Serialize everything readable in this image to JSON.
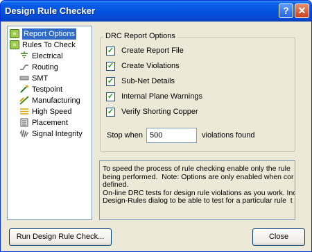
{
  "window": {
    "title": "Design Rule Checker",
    "help_label": "?",
    "close_label": "✕"
  },
  "tree": {
    "items": [
      {
        "label": "Report Options",
        "icon": "report-options-icon",
        "selected": true
      },
      {
        "label": "Rules To Check",
        "icon": "rules-folder-icon",
        "selected": false
      },
      {
        "label": "Electrical",
        "icon": "electrical-icon",
        "selected": false
      },
      {
        "label": "Routing",
        "icon": "routing-icon",
        "selected": false
      },
      {
        "label": "SMT",
        "icon": "smt-icon",
        "selected": false
      },
      {
        "label": "Testpoint",
        "icon": "testpoint-icon",
        "selected": false
      },
      {
        "label": "Manufacturing",
        "icon": "manufacturing-icon",
        "selected": false
      },
      {
        "label": "High Speed",
        "icon": "high-speed-icon",
        "selected": false
      },
      {
        "label": "Placement",
        "icon": "placement-icon",
        "selected": false
      },
      {
        "label": "Signal Integrity",
        "icon": "signal-integrity-icon",
        "selected": false
      }
    ]
  },
  "drc_options": {
    "group_label": "DRC Report Options",
    "checkboxes": [
      {
        "label": "Create Report File",
        "checked": true
      },
      {
        "label": "Create Violations",
        "checked": true
      },
      {
        "label": "Sub-Net Details",
        "checked": true
      },
      {
        "label": "Internal Plane Warnings",
        "checked": true
      },
      {
        "label": "Verify Shorting Copper",
        "checked": true
      }
    ],
    "stop_when_label": "Stop when",
    "stop_when_value": "500",
    "violations_found_label": "violations found"
  },
  "info_text": "To speed the process of rule checking enable only the rule\nbeing performed.  Note: Options are only enabled when cor\ndefined.\nOn-line DRC tests for design rule violations as you work. Inc\nDesign-Rules dialog to be able to test for a particular rule  t",
  "buttons": {
    "run_label": "Run Design Rule Check...",
    "close_label": "Close"
  },
  "colors": {
    "selection": "#316ac5",
    "titlebar": "#0553e0",
    "check": "#21a121"
  }
}
